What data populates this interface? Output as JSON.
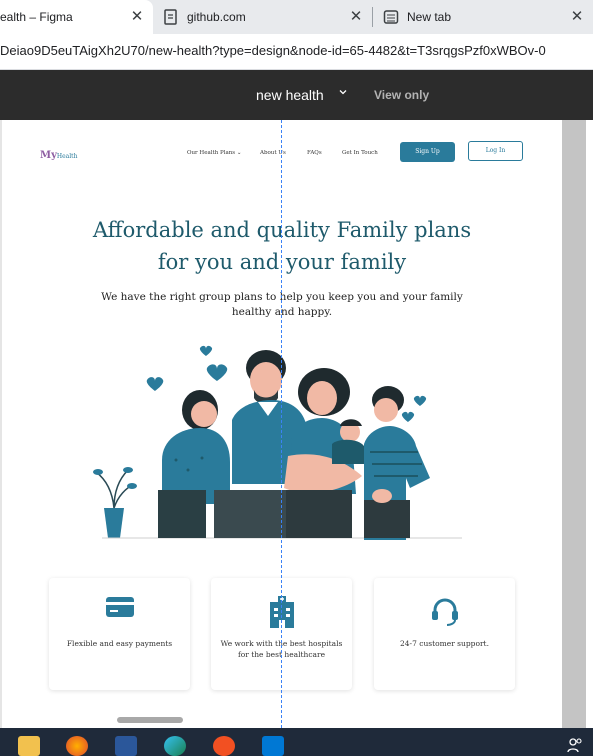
{
  "browser": {
    "tabs": [
      {
        "label": "ealth – Figma",
        "active": true
      },
      {
        "label": "github.com",
        "active": false
      },
      {
        "label": "New tab",
        "active": false
      }
    ],
    "close_glyph": "✕",
    "url": "Deiao9D5euTAigXh2U70/new-health?type=design&node-id=65-4482&t=T3srqgsPzf0xWBOv-0"
  },
  "figma": {
    "file_title": "new health",
    "mode": "View only"
  },
  "site": {
    "logo_main": "My",
    "logo_sub": "Health",
    "nav": {
      "plans": "Our Health Plans ⌄",
      "about": "About Us",
      "faqs": "FAQs",
      "contact": "Get In Touch",
      "signup": "Sign Up",
      "login": "Log In"
    },
    "hero": {
      "title_line1": "Affordable and quality Family  plans",
      "title_line2": "for you and your family",
      "subtitle_line1": "We have the right group plans to help you keep you and your family",
      "subtitle_line2": "healthy and happy."
    },
    "features": [
      {
        "icon": "credit-card-icon",
        "text": "Flexible and easy payments"
      },
      {
        "icon": "hospital-icon",
        "text": "We work with the best hospitals for the best healthcare"
      },
      {
        "icon": "headset-icon",
        "text": "24-7 customer support."
      }
    ]
  },
  "colors": {
    "brand": "#2a7b9b",
    "heading": "#1e5a6b",
    "figma_bar": "#2c2c2c",
    "taskbar": "#1f2a3a"
  },
  "taskbar": {
    "apps": [
      "file-explorer-icon",
      "firefox-icon",
      "word-icon",
      "edge-icon",
      "figma-app-icon",
      "vscode-icon",
      "people-icon"
    ]
  }
}
